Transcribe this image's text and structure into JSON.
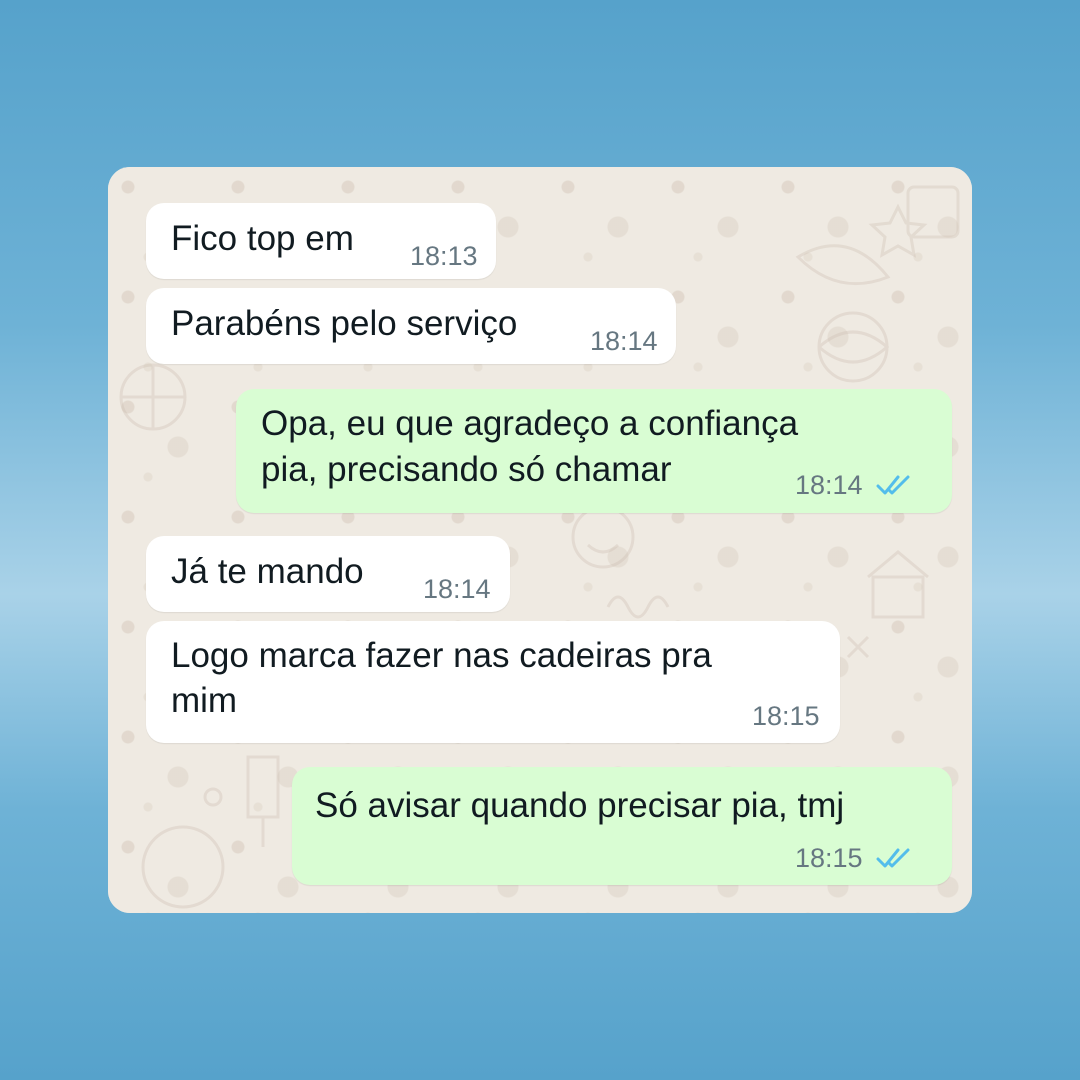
{
  "colors": {
    "incoming_bubble": "#ffffff",
    "outgoing_bubble": "#d9fdd3",
    "read_ticks": "#53bdeb",
    "timestamp": "#667781",
    "wallpaper": "#efeae2"
  },
  "messages": [
    {
      "direction": "incoming",
      "text": "Fico top em",
      "time": "18:13"
    },
    {
      "direction": "incoming",
      "text": "Parabéns pelo serviço",
      "time": "18:14"
    },
    {
      "direction": "outgoing",
      "line1": "Opa, eu que agradeço a confiança",
      "line2": "pia, precisando só chamar",
      "time": "18:14",
      "status_icon": "double-check-read-icon"
    },
    {
      "direction": "incoming",
      "text": "Já te mando",
      "time": "18:14"
    },
    {
      "direction": "incoming",
      "line1": "Logo marca fazer nas cadeiras pra",
      "line2": "mim",
      "time": "18:15"
    },
    {
      "direction": "outgoing",
      "text": "Só avisar quando precisar pia, tmj",
      "time": "18:15",
      "status_icon": "double-check-read-icon"
    }
  ]
}
